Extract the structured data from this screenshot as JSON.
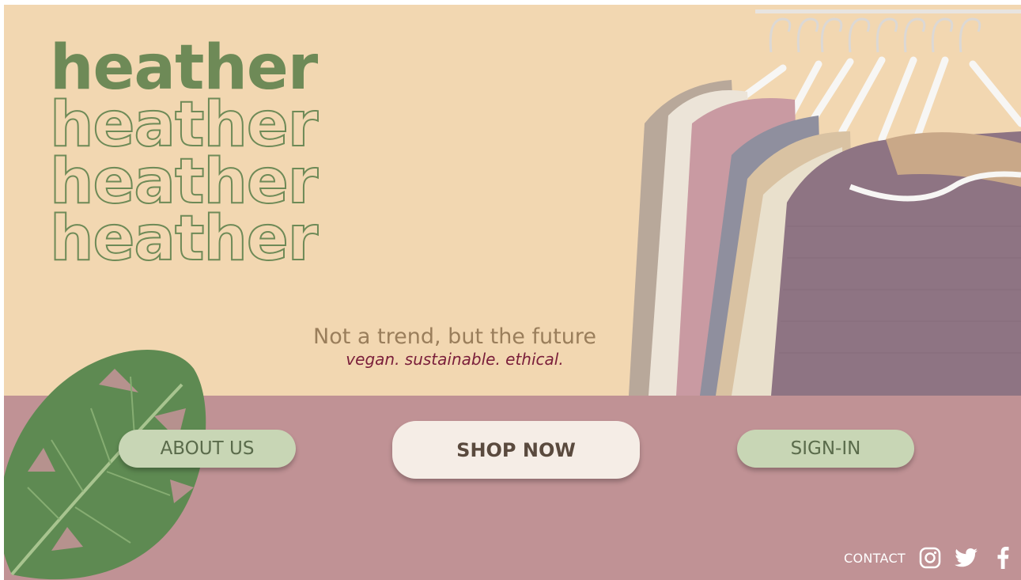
{
  "brand": {
    "lines": [
      "heather",
      "heather",
      "heather",
      "heather"
    ]
  },
  "tagline": {
    "headline": "Not a trend, but the future",
    "subline": "vegan. sustainable. ethical."
  },
  "nav": {
    "about_label": "ABOUT US",
    "shop_label": "SHOP NOW",
    "signin_label": "SIGN-IN"
  },
  "footer": {
    "contact_label": "CONTACT",
    "social_icons": [
      "instagram-icon",
      "twitter-icon",
      "facebook-icon"
    ]
  },
  "colors": {
    "top_background": "#f2d7b1",
    "bottom_background": "#c09295",
    "brand_green": "#6e8a57",
    "tagline_brown": "#9a7e5b",
    "tagline_maroon": "#7a1e3a",
    "secondary_button": "#c8d6b5",
    "primary_button": "#f5ede6"
  },
  "images": {
    "hero": "sweaters-on-hangers-photo",
    "decoration": "monstera-leaf"
  }
}
